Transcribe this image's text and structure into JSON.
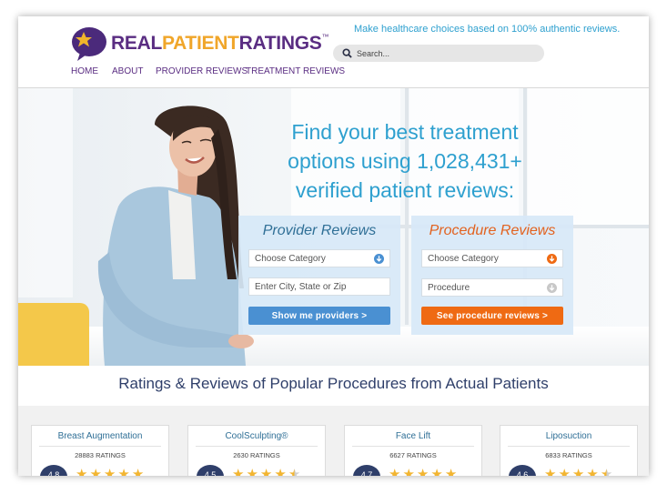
{
  "header": {
    "logo": {
      "part1": "REAL",
      "part2": "PATIENT",
      "part3": "RATINGS",
      "tm": "™"
    },
    "tagline": "Make healthcare choices based on 100% authentic reviews.",
    "search": {
      "placeholder": "Search..."
    },
    "nav": [
      {
        "label": "HOME"
      },
      {
        "label": "ABOUT"
      },
      {
        "label": "PROVIDER REVIEWS"
      },
      {
        "label": "TREATMENT REVIEWS"
      }
    ]
  },
  "hero": {
    "title": "Find your best treatment options using 1,028,431+ verified patient reviews:",
    "provider_panel": {
      "title": "Provider Reviews",
      "category_value": "Choose Category",
      "location_placeholder": "Enter City, State or Zip",
      "button": "Show me providers >"
    },
    "procedure_panel": {
      "title": "Procedure Reviews",
      "category_value": "Choose Category",
      "procedure_value": "Procedure",
      "button": "See procedure reviews >"
    }
  },
  "section": {
    "title": "Ratings & Reviews of Popular Procedures from Actual Patients",
    "cards": [
      {
        "name": "Breast Augmentation",
        "count": "28883 RATINGS",
        "score": "4.8",
        "stars": 5
      },
      {
        "name": "CoolSculpting®",
        "count": "2630 RATINGS",
        "score": "4.5",
        "stars": 4.5
      },
      {
        "name": "Face Lift",
        "count": "6627 RATINGS",
        "score": "4.7",
        "stars": 5
      },
      {
        "name": "Liposuction",
        "count": "6833 RATINGS",
        "score": "4.6",
        "stars": 4.5
      }
    ]
  },
  "colors": {
    "brand_purple": "#5a2d82",
    "brand_gold": "#f0a62a",
    "accent_blue": "#2ea0cf",
    "button_blue": "#4a90d2",
    "button_orange": "#ef6a13",
    "star_gold": "#f2b531"
  }
}
